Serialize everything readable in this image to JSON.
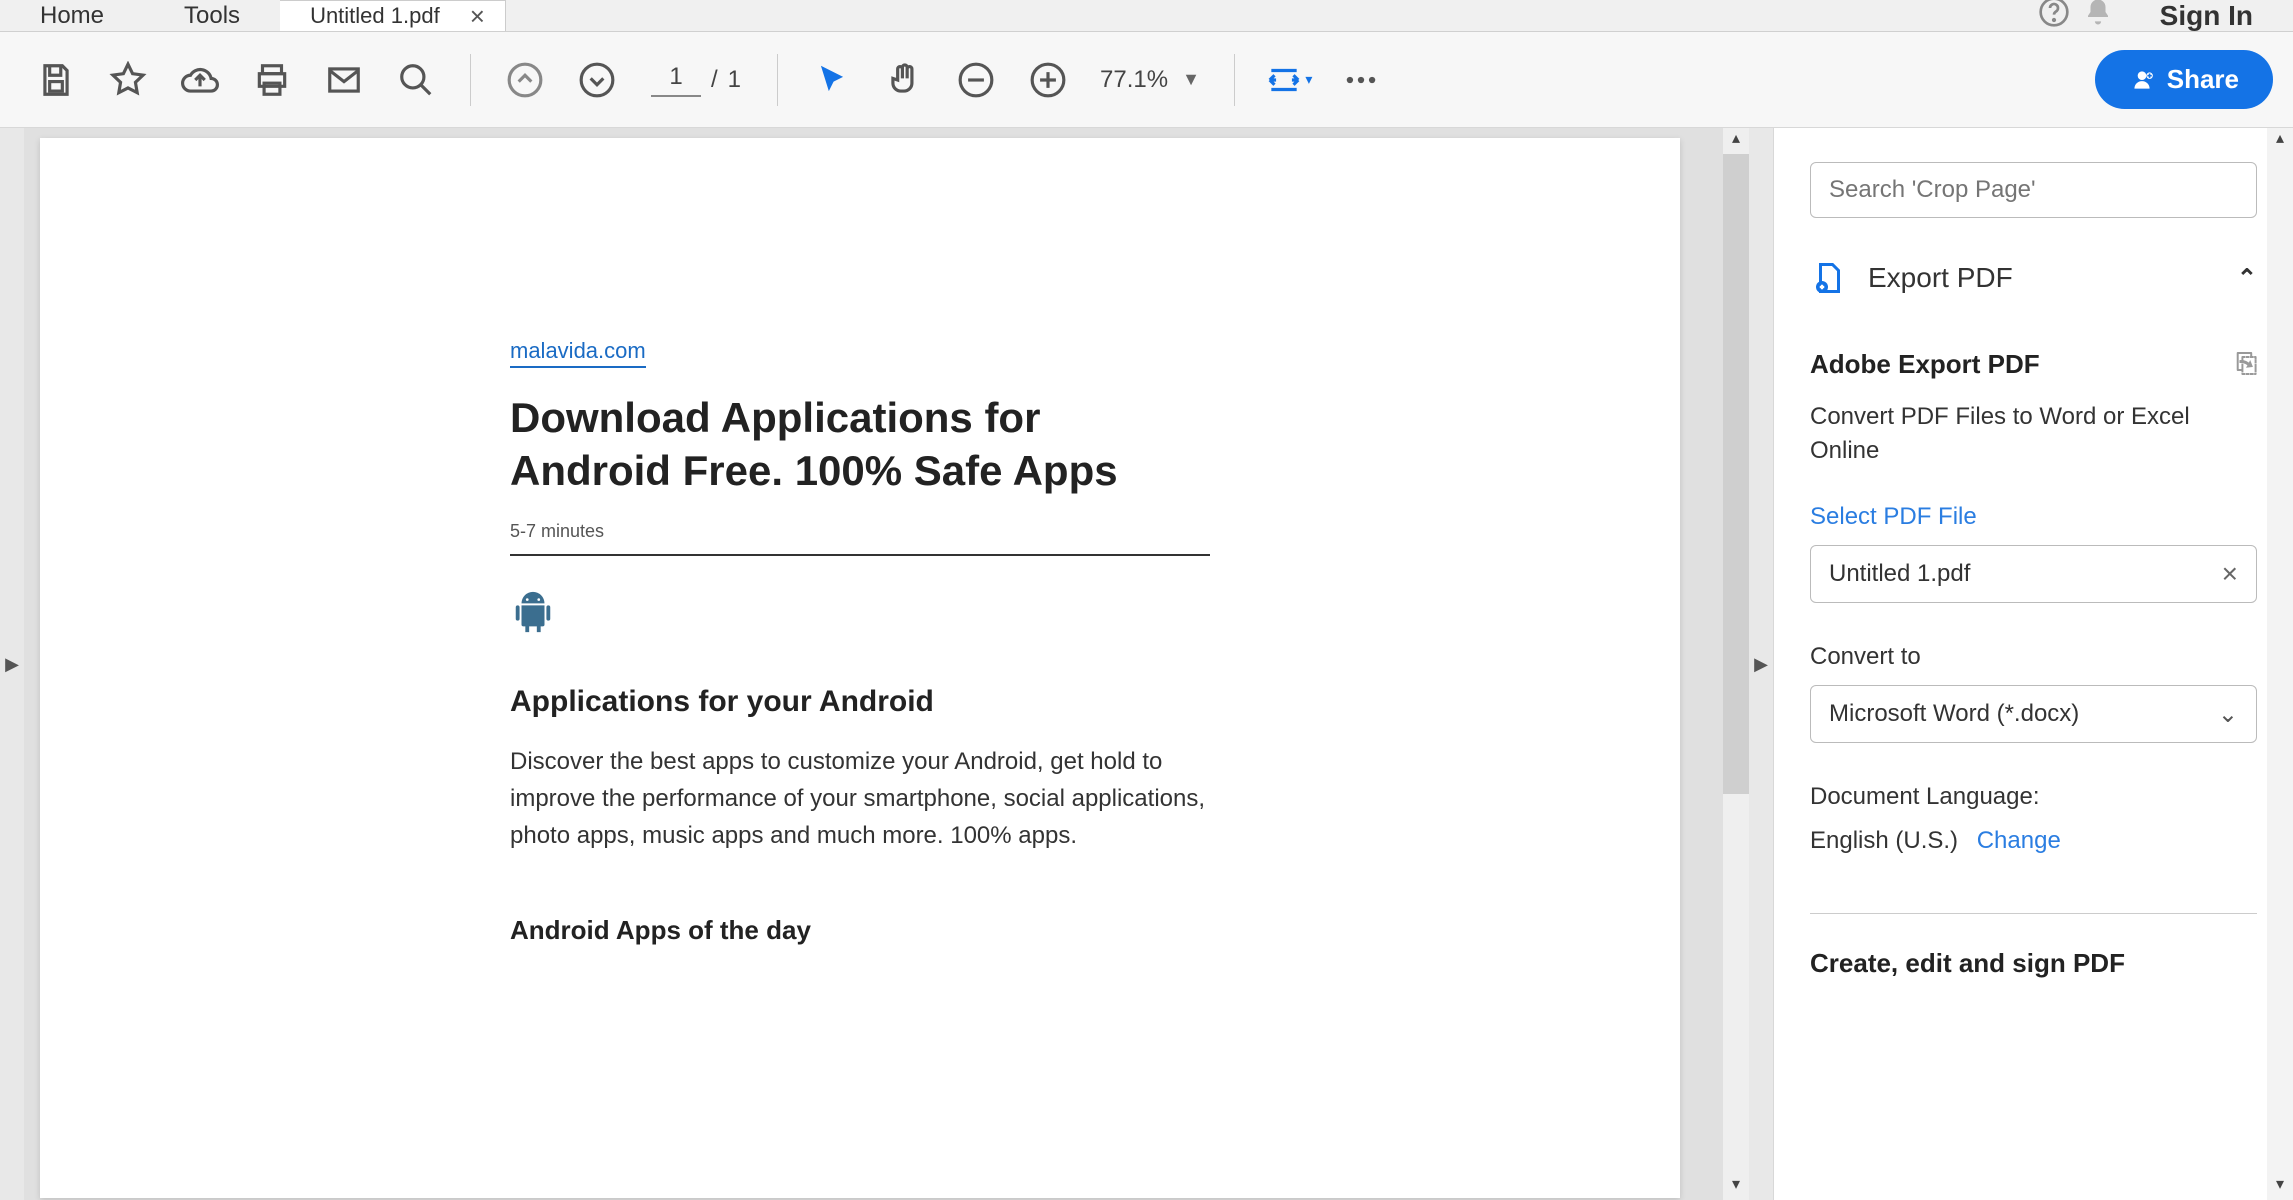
{
  "tabs": {
    "home": "Home",
    "tools": "Tools",
    "doc_title": "Untitled 1.pdf",
    "sign_in": "Sign In"
  },
  "toolbar": {
    "page_current": "1",
    "page_sep": "/",
    "page_total": "1",
    "zoom": "77.1%",
    "share": "Share"
  },
  "document": {
    "source_link": "malavida.com",
    "title": "Download Applications for Android Free. 100% Safe Apps",
    "read_time": "5-7 minutes",
    "heading2": "Applications for your Android",
    "paragraph": "Discover the best apps to customize your Android, get hold to improve the performance of your smartphone, social applications, photo apps, music apps and much more. 100% apps.",
    "heading3": "Android Apps of the day"
  },
  "right": {
    "search_placeholder": "Search 'Crop Page'",
    "export_tool": "Export PDF",
    "export_title": "Adobe Export PDF",
    "export_desc": "Convert PDF Files to Word or Excel Online",
    "select_file_label": "Select PDF File",
    "selected_file": "Untitled 1.pdf",
    "convert_to_label": "Convert to",
    "convert_to_value": "Microsoft Word (*.docx)",
    "doc_lang_label": "Document Language:",
    "doc_lang_value": "English (U.S.)",
    "change": "Change",
    "next_tool": "Create, edit and sign PDF"
  }
}
